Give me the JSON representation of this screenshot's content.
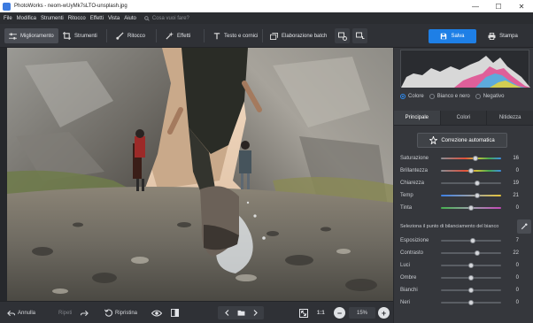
{
  "window": {
    "title": "PhotoWorks - neom-wUyMk7sLTO-unsplash.jpg",
    "minimize": "—",
    "maximize": "☐",
    "close": "✕"
  },
  "menu": {
    "items": [
      "File",
      "Modifica",
      "Strumenti",
      "Ritocco",
      "Effetti",
      "Vista",
      "Aiuto"
    ],
    "search_placeholder": "Cosa vuoi fare?"
  },
  "toolbar": {
    "tabs": [
      "Miglioramento",
      "Strumenti",
      "Ritocco",
      "Effetti",
      "Testo e cornici",
      "Elaborazione batch"
    ],
    "active_tab": "Miglioramento",
    "save_label": "Salva",
    "print_label": "Stampa"
  },
  "right_panel": {
    "modes": [
      "Colore",
      "Bianco e nero",
      "Negativo"
    ],
    "selected_mode": "Colore",
    "tabs": [
      "Principale",
      "Colori",
      "Nitidezza"
    ],
    "active_tab": "Principale",
    "auto_button": "Correzione automatica",
    "sliders_top": [
      {
        "label": "Saturazione",
        "value": 16,
        "fraction": 0.58,
        "gradient": "sat"
      },
      {
        "label": "Brillantezza",
        "value": 0,
        "fraction": 0.5,
        "gradient": "sat"
      },
      {
        "label": "Chiarezza",
        "value": 19,
        "fraction": 0.6,
        "gradient": "none"
      },
      {
        "label": "Temp",
        "value": 21,
        "fraction": 0.61,
        "gradient": "temp"
      },
      {
        "label": "Tinta",
        "value": 0,
        "fraction": 0.5,
        "gradient": "tint"
      }
    ],
    "white_balance_label": "Seleziona il punto di bilanciamento del bianco",
    "sliders_bottom": [
      {
        "label": "Esposizione",
        "value": 7,
        "fraction": 0.53
      },
      {
        "label": "Contrasto",
        "value": 22,
        "fraction": 0.61
      },
      {
        "label": "Luci",
        "value": 0,
        "fraction": 0.5
      },
      {
        "label": "Ombre",
        "value": 0,
        "fraction": 0.5
      },
      {
        "label": "Bianchi",
        "value": 0,
        "fraction": 0.5
      },
      {
        "label": "Neri",
        "value": 0,
        "fraction": 0.5
      }
    ]
  },
  "bottom": {
    "undo": "Annulla",
    "redo": "Ripeti",
    "restore": "Ripristina",
    "one_to_one": "1:1",
    "zoom": "15%",
    "zoom_out": "−",
    "zoom_in": "+"
  },
  "colors": {
    "accent": "#1e7fe6",
    "panel": "#35373c",
    "toolbar": "#2f3136"
  }
}
